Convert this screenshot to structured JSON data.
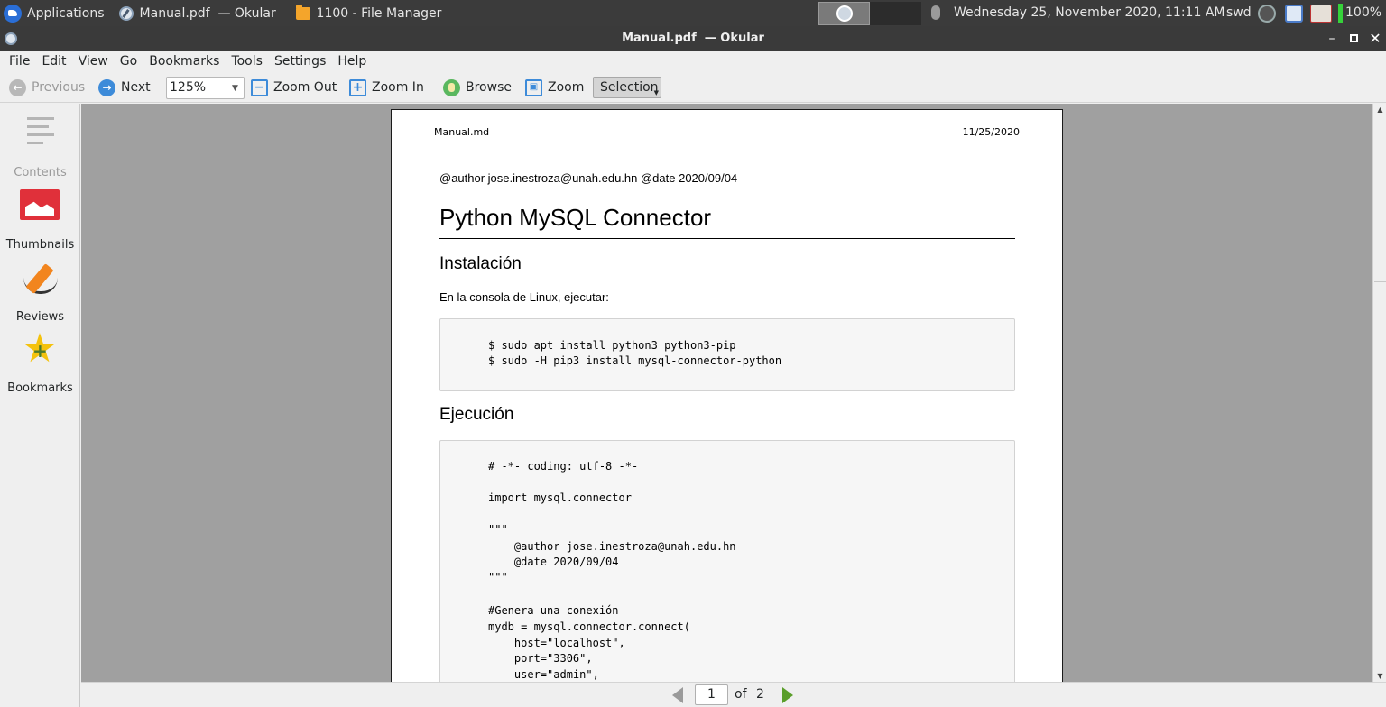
{
  "taskbar": {
    "apps_label": "Applications",
    "window1": "Manual.pdf  — Okular",
    "window2": "1100 - File Manager",
    "clock": "Wednesday 25, November 2020, 11:11 AM",
    "user": "swd",
    "battery": "100%"
  },
  "window": {
    "title": "Manual.pdf  — Okular"
  },
  "menu": [
    "File",
    "Edit",
    "View",
    "Go",
    "Bookmarks",
    "Tools",
    "Settings",
    "Help"
  ],
  "toolbar": {
    "previous": "Previous",
    "next": "Next",
    "zoom_value": "125%",
    "zoom_out": "Zoom Out",
    "zoom_in": "Zoom In",
    "browse": "Browse",
    "zoom": "Zoom",
    "selection": "Selection"
  },
  "sidebar": {
    "contents": "Contents",
    "thumbnails": "Thumbnails",
    "reviews": "Reviews",
    "bookmarks": "Bookmarks"
  },
  "page": {
    "header_left": "Manual.md",
    "header_right": "11/25/2020",
    "author_line": "@author jose.inestroza@unah.edu.hn @date 2020/09/04",
    "title": "Python MySQL Connector",
    "section1": "Instalación",
    "section1_text": "En la consola de Linux, ejecutar:",
    "code1": [
      "$ sudo apt install python3 python3-pip",
      "$ sudo -H pip3 install mysql-connector-python"
    ],
    "section2": "Ejecución",
    "code2": [
      "# -*- coding: utf-8 -*-",
      "",
      "import mysql.connector",
      "",
      "\"\"\"",
      "    @author jose.inestroza@unah.edu.hn",
      "    @date 2020/09/04",
      "\"\"\"",
      "",
      "#Genera una conexión",
      "mydb = mysql.connector.connect(",
      "    host=\"localhost\",",
      "    port=\"3306\",",
      "    user=\"admin\","
    ]
  },
  "pager": {
    "current": "1",
    "of_label": "of",
    "total": "2"
  }
}
